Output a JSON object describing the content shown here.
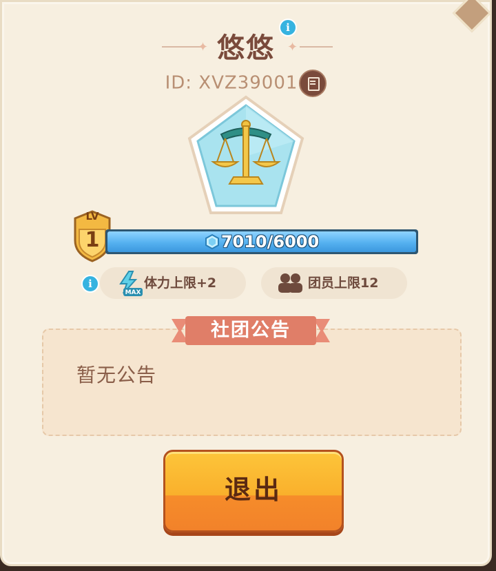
{
  "profile": {
    "name": "悠悠",
    "id_label": "ID: XVZ39001"
  },
  "level": {
    "badge_text": "LV",
    "value": "1",
    "progress_text": "7010/6000",
    "progress_fraction": 1.0
  },
  "perks": [
    {
      "label": "体力上限+2",
      "icon": "stamina-max-icon"
    },
    {
      "label": "团员上限12",
      "icon": "members-icon"
    }
  ],
  "notice": {
    "header": "社团公告",
    "content": "暂无公告"
  },
  "actions": {
    "exit_label": "退出"
  },
  "icons": {
    "info": "i"
  },
  "colors": {
    "panel_bg": "#f7efe0",
    "title_text": "#7a4a3b",
    "progress_fill": "#55b1f0",
    "exit_button": "#f9b02c",
    "ribbon": "#e58f78",
    "info_dot": "#36b3e0"
  }
}
